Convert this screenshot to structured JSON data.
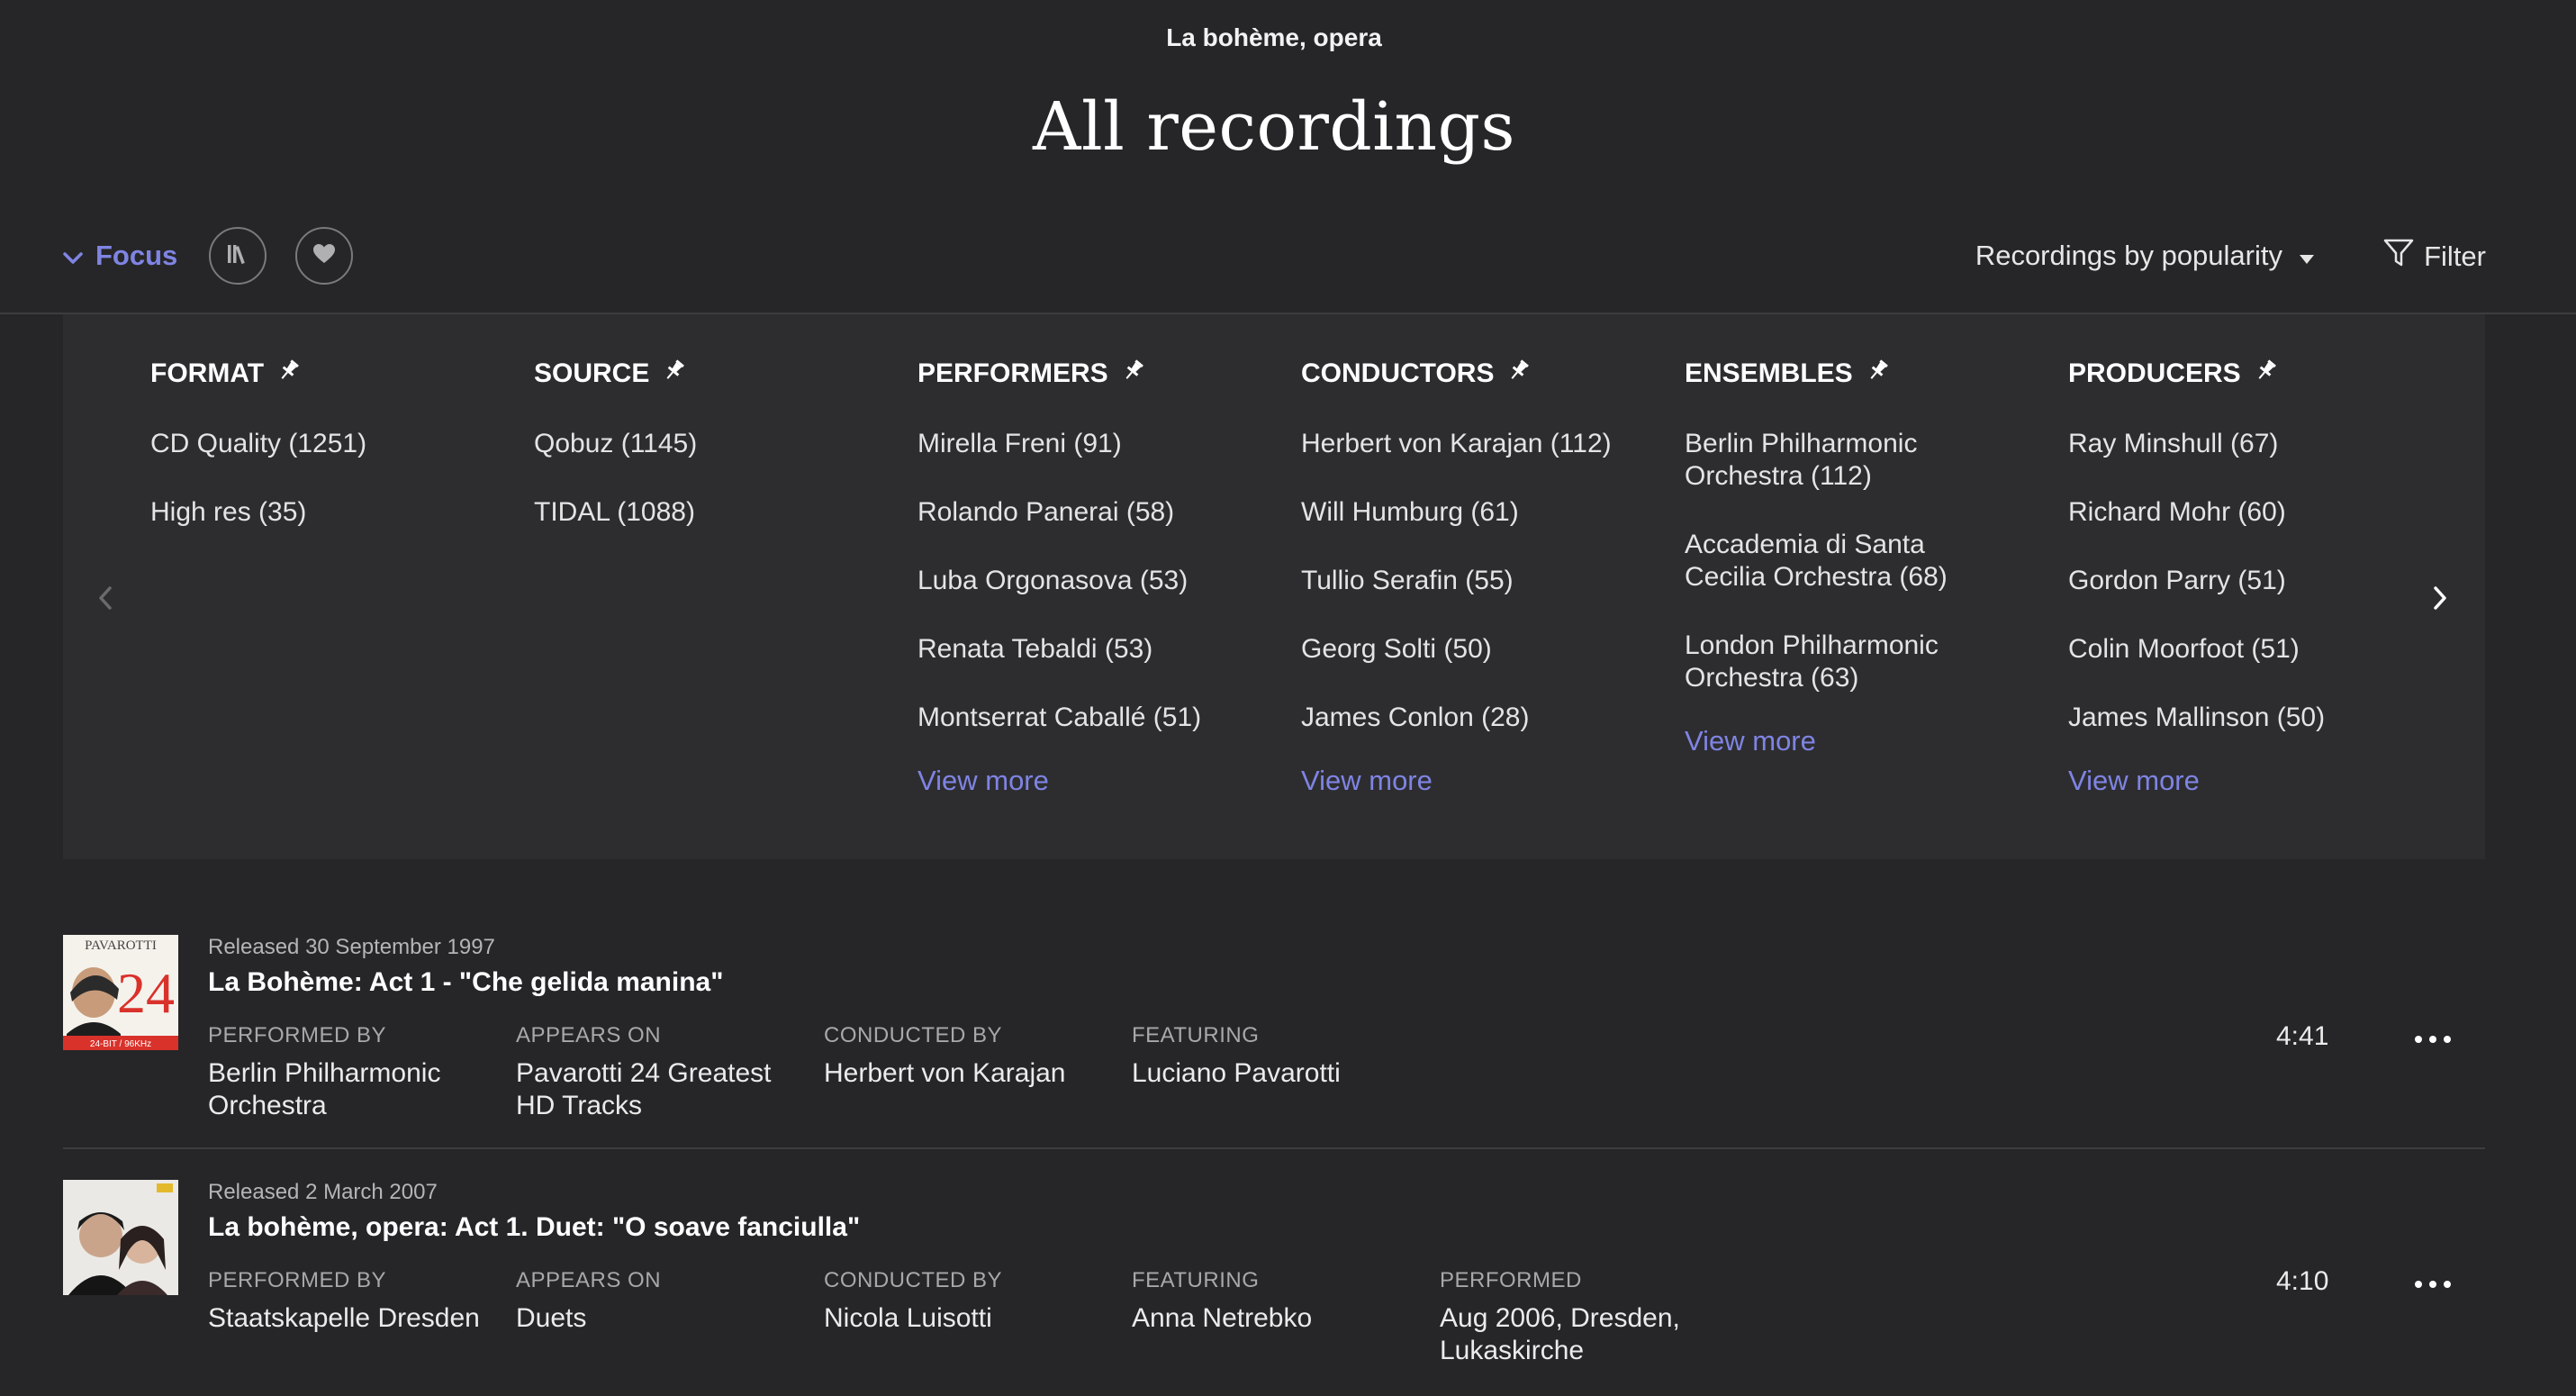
{
  "header": {
    "work": "La bohème, opera",
    "title": "All recordings"
  },
  "toolbar": {
    "focus_label": "Focus",
    "sort_label": "Recordings by popularity",
    "filter_label": "Filter"
  },
  "filters": {
    "columns": [
      {
        "heading": "FORMAT",
        "items": [
          "CD Quality (1251)",
          "High res (35)"
        ],
        "view_more": ""
      },
      {
        "heading": "SOURCE",
        "items": [
          "Qobuz (1145)",
          "TIDAL (1088)"
        ],
        "view_more": ""
      },
      {
        "heading": "PERFORMERS",
        "items": [
          "Mirella Freni (91)",
          "Rolando Panerai (58)",
          "Luba Orgonasova (53)",
          "Renata Tebaldi (53)",
          "Montserrat Caballé (51)"
        ],
        "view_more": "View more"
      },
      {
        "heading": "CONDUCTORS",
        "items": [
          "Herbert von Karajan (112)",
          "Will Humburg (61)",
          "Tullio Serafin (55)",
          "Georg Solti (50)",
          "James Conlon (28)"
        ],
        "view_more": "View more"
      },
      {
        "heading": "ENSEMBLES",
        "items": [
          "Berlin Philharmonic Orchestra (112)",
          "Accademia di Santa Cecilia Orchestra (68)",
          "London Philharmonic Orchestra (63)"
        ],
        "view_more": "View more"
      },
      {
        "heading": "PRODUCERS",
        "items": [
          "Ray Minshull (67)",
          "Richard Mohr (60)",
          "Gordon Parry (51)",
          "Colin Moorfoot (51)",
          "James Mallinson (50)"
        ],
        "view_more": "View more"
      }
    ]
  },
  "recordings": [
    {
      "released": "Released 30 September 1997",
      "title": "La Bohème: Act 1 - \"Che gelida manina\"",
      "cover_top_text": "PAVAROTTI",
      "cover_number": "24",
      "cover_bottom_text": "24-BIT / 96KHz",
      "duration": "4:41",
      "meta": [
        {
          "label": "PERFORMED BY",
          "value": "Berlin Philharmonic Orchestra"
        },
        {
          "label": "APPEARS ON",
          "value": "Pavarotti 24 Greatest HD Tracks"
        },
        {
          "label": "CONDUCTED BY",
          "value": "Herbert von Karajan"
        },
        {
          "label": "FEATURING",
          "value": "Luciano Pavarotti"
        }
      ]
    },
    {
      "released": "Released 2 March 2007",
      "title": "La bohème, opera: Act 1. Duet: \"O soave fanciulla\"",
      "duration": "4:10",
      "meta": [
        {
          "label": "PERFORMED BY",
          "value": "Staatskapelle Dresden"
        },
        {
          "label": "APPEARS ON",
          "value": "Duets"
        },
        {
          "label": "CONDUCTED BY",
          "value": "Nicola Luisotti"
        },
        {
          "label": "FEATURING",
          "value": "Anna Netrebko"
        },
        {
          "label": "PERFORMED",
          "value": "Aug 2006, Dresden, Lukaskirche"
        }
      ]
    }
  ],
  "colors": {
    "background": "#262628",
    "panel": "#2d2d30",
    "accent": "#7f84e3",
    "text": "#ececec"
  },
  "icons": [
    "chevron-down-icon",
    "library-icon",
    "heart-icon",
    "caret-down-icon",
    "filter-funnel-icon",
    "pin-icon",
    "chevron-left-icon",
    "chevron-right-icon",
    "more-dots-icon"
  ]
}
